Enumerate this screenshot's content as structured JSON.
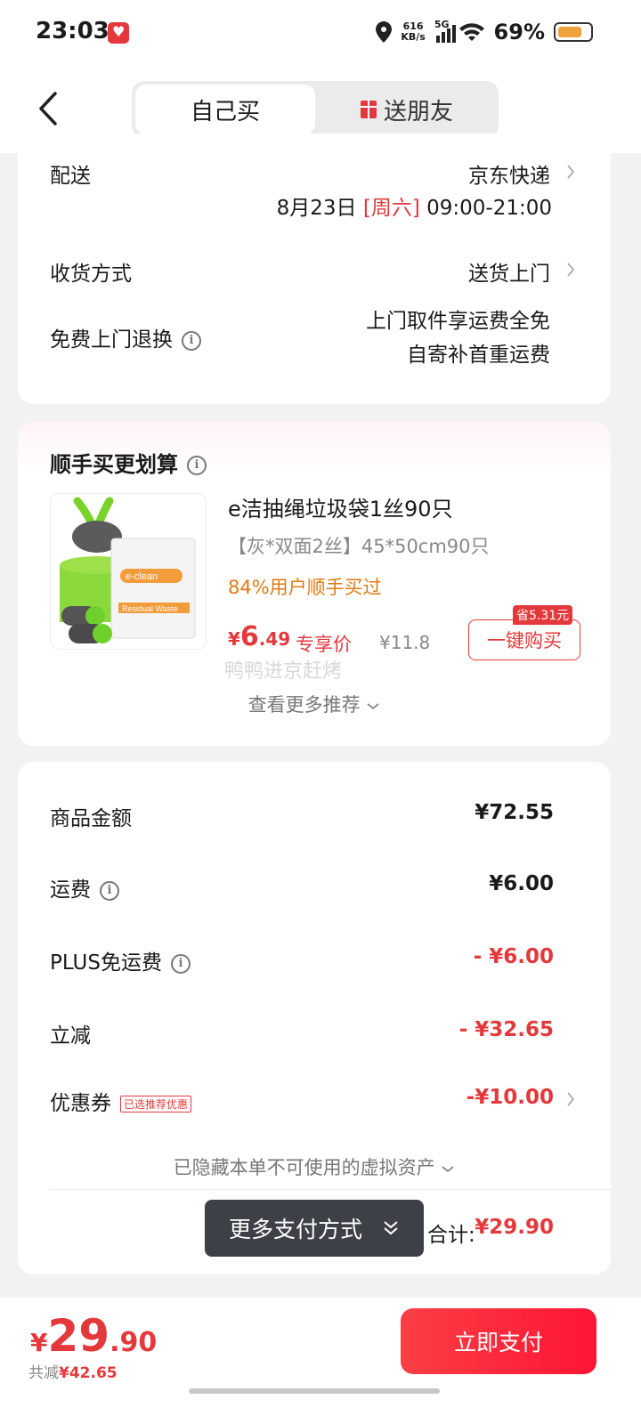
{
  "status_bar": {
    "time": "23:03",
    "speed_top": "616",
    "speed_bottom": "KB/s",
    "network": "5G",
    "battery_percent": "69%"
  },
  "header": {
    "tab_self": "自己买",
    "tab_gift": "送朋友"
  },
  "delivery": {
    "label": "配送",
    "carrier": "京东快递",
    "date": "8月23日",
    "weekday": "[周六]",
    "time_window": "09:00-21:00",
    "receive_label": "收货方式",
    "receive_value": "送货上门",
    "return_label": "免费上门退换",
    "return_line1": "上门取件享运费全免",
    "return_line2": "自寄补首重运费"
  },
  "addon": {
    "title": "顺手买更划算",
    "product_title": "e洁抽绳垃圾袋1丝90只",
    "product_spec": "【灰*双面2丝】45*50cm90只",
    "social_proof": "84%用户顺手买过",
    "price_yen": "¥",
    "price_int": "6",
    "price_dec": ".49",
    "price_tag": "专享价",
    "original_price": "¥11.8",
    "save_tag": "省5.31元",
    "buy_button": "一键购买",
    "watermark": "鸭鸭进京赶烤",
    "more": "查看更多推荐"
  },
  "summary": {
    "goods_label": "商品金额",
    "goods_value": "¥72.55",
    "shipping_label": "运费",
    "shipping_value": "¥6.00",
    "plus_label": "PLUS免运费",
    "plus_value": "- ¥6.00",
    "discount_label": "立减",
    "discount_value": "- ¥32.65",
    "coupon_label": "优惠券",
    "coupon_chip": "已选推荐优惠",
    "coupon_value": "-¥10.00",
    "hidden_note": "已隐藏本单不可使用的虚拟资产",
    "total_label": "合计:",
    "total_value": "¥29.90"
  },
  "tooltip": {
    "label": "更多支付方式"
  },
  "bottom": {
    "yen": "¥",
    "int": "29",
    "dec": ".90",
    "saved_label": "共减",
    "saved_value": "¥42.65",
    "pay_button": "立即支付"
  },
  "colors": {
    "accent": "#e4393c",
    "orange": "#e07a14"
  }
}
